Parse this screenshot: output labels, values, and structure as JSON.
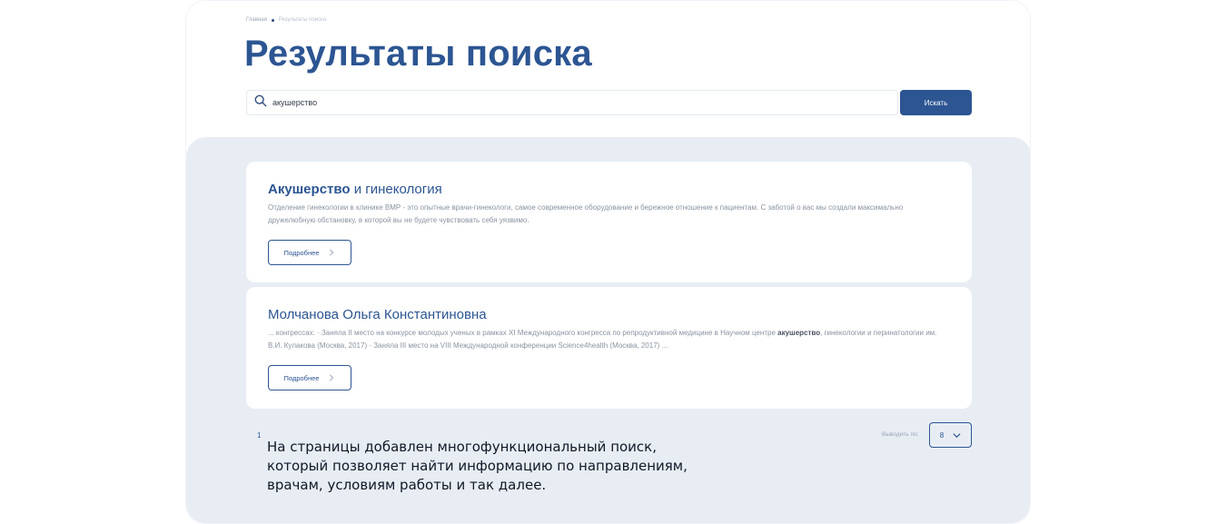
{
  "breadcrumb": {
    "home": "Главная",
    "current": "Результаты поиска"
  },
  "page_title": "Результаты поиска",
  "search": {
    "value": "акушерство",
    "button_label": "Искать",
    "icon": "search-icon"
  },
  "results": [
    {
      "title_highlight": "Акушерство",
      "title_rest": " и гинекология",
      "text": "Отделение гинекологии в клинике ВМР - это опытные врачи-гинекологи, самое современное оборудование и бережное отношение к пациентам. С заботой о вас мы создали максимально дружелюбную обстановку, в которой вы не будете чувствовать себя уязвимо.",
      "button_label": "Подробнее"
    },
    {
      "title": "Молчанова Ольга Константиновна",
      "text_before": "... конгрессах: · Заняла II место на конкурсе молодых ученых в рамках XI Международного конгресса по репродуктивной медицине в Научном центре ",
      "text_highlight": "акушерство",
      "text_after": ", гинекологии и перинатологии им. В.И. Кулакова (Москва, 2017) · Заняла III место на VIII Международной конференции Science4health (Москва, 2017) ...",
      "button_label": "Подробнее"
    }
  ],
  "pagination": {
    "current_page": "1",
    "show_label": "Выводить по:",
    "per_page_value": "8"
  },
  "caption": "На страницы добавлен многофункциональный поиск, который позволяет найти информацию по направлениям, врачам, условиям работы и так далее.",
  "colors": {
    "accent": "#2c5592",
    "panel_bg": "#e8edf4",
    "muted_text": "#8a93a2"
  }
}
